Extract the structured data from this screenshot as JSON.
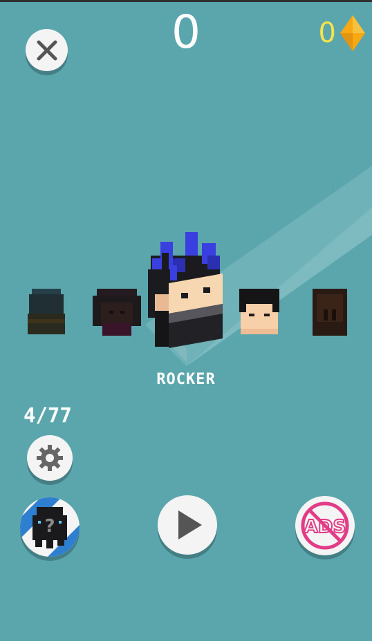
{
  "hud": {
    "score": "0",
    "gem_count": "0",
    "close_icon": "close-icon",
    "gem_icon": "gem-icon"
  },
  "selection": {
    "character_name": "ROCKER",
    "unlocked_count": "4/77",
    "characters": [
      "locked",
      "locked",
      "rocker",
      "boy",
      "locked"
    ]
  },
  "buttons": {
    "settings_icon": "gear-icon",
    "mystery_icon": "mystery-character-icon",
    "play_icon": "play-icon",
    "noads_label": "ADS",
    "noads_icon": "no-ads-icon"
  },
  "colors": {
    "background": "#5ba6ad",
    "gem": "#f6a913",
    "gem_text": "#f6e34a",
    "noads_accent": "#e23c86",
    "rocker_hair": "#3a3fe0"
  }
}
